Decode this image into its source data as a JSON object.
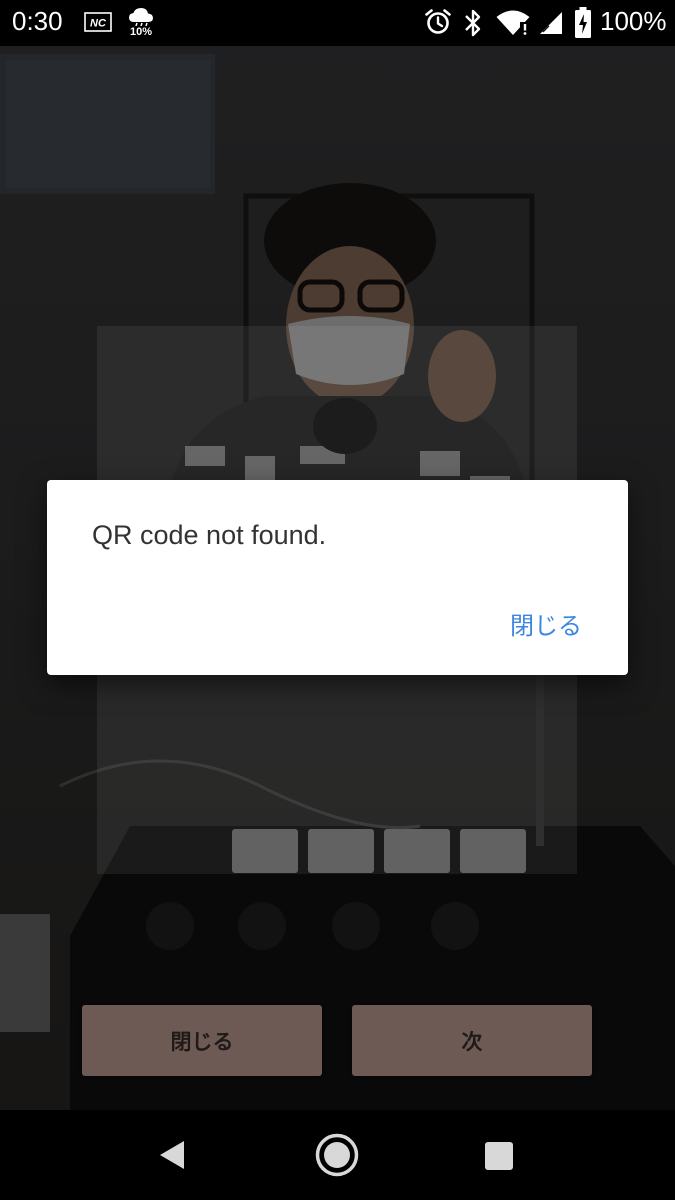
{
  "status_bar": {
    "time": "0:30",
    "nfc_text": "NC",
    "weather_text": "10%",
    "battery_text": "100%"
  },
  "dialog": {
    "message": "QR code not found.",
    "close_label": "閉じる"
  },
  "bottom_buttons": {
    "close_label": "閉じる",
    "next_label": "次"
  },
  "colors": {
    "accent": "#3a86e0",
    "button_bg": "#6e5a54",
    "dialog_bg": "#ffffff"
  },
  "icons": [
    "nfc-icon",
    "weather-icon",
    "alarm-icon",
    "bluetooth-icon",
    "wifi-icon",
    "signal-icon",
    "battery-icon",
    "back-icon",
    "home-icon",
    "recents-icon"
  ]
}
